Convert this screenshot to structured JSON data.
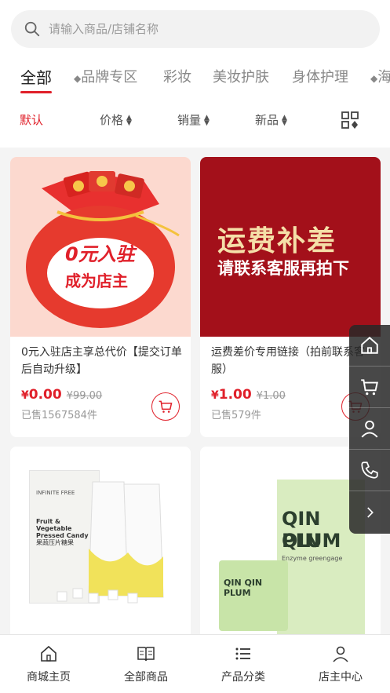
{
  "search": {
    "placeholder": "请输入商品/店铺名称"
  },
  "categories": [
    "全部",
    "品牌专区",
    "彩妆",
    "美妆护肤",
    "身体护理",
    "海"
  ],
  "sort": {
    "default": "默认",
    "price": "价格",
    "sales": "销量",
    "newest": "新品"
  },
  "products": [
    {
      "title": "0元入驻店主享总代价【提交订单后自动升级】",
      "currency": "¥",
      "price": "0.00",
      "old_price": "¥99.00",
      "sold": "已售1567584件",
      "banner_line1": "0元入驻",
      "banner_line2": "成为店主"
    },
    {
      "title": "运费差价专用链接（拍前联系客服）",
      "currency": "¥",
      "price": "1.00",
      "old_price": "¥1.00",
      "sold": "已售579件",
      "banner_line1": "运费补差",
      "banner_line2": "请联系客服再拍下"
    },
    {
      "title": "",
      "brand": "INFINITE FREE",
      "name_en": "Fruit & Vegetable Pressed Candy",
      "name_cn": "果蔬压片糖果"
    },
    {
      "title": "",
      "name_en1": "QIN QIN",
      "name_en2": "PLUM",
      "sub": "Enzyme greengage"
    }
  ],
  "tabbar": [
    "商城主页",
    "全部商品",
    "产品分类",
    "店主中心"
  ],
  "colors": {
    "accent": "#e0202a",
    "banner_pink": "#fcd9cf",
    "banner_red": "#a3101a"
  }
}
